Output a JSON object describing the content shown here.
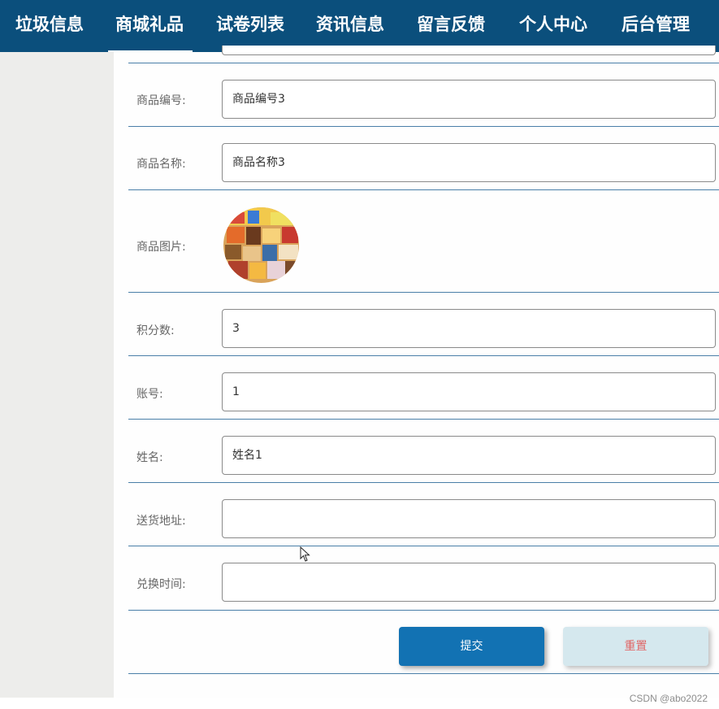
{
  "nav": {
    "items": [
      {
        "label": "垃圾信息",
        "active": false
      },
      {
        "label": "商城礼品",
        "active": true
      },
      {
        "label": "试卷列表",
        "active": false
      },
      {
        "label": "资讯信息",
        "active": false
      },
      {
        "label": "留言反馈",
        "active": false
      },
      {
        "label": "个人中心",
        "active": false
      },
      {
        "label": "后台管理",
        "active": false
      }
    ]
  },
  "form": {
    "product_no": {
      "label": "商品编号:",
      "value": "商品编号3"
    },
    "product_name": {
      "label": "商品名称:",
      "value": "商品名称3"
    },
    "product_image": {
      "label": "商品图片:"
    },
    "points": {
      "label": "积分数:",
      "value": "3"
    },
    "account": {
      "label": "账号:",
      "value": "1"
    },
    "name": {
      "label": "姓名:",
      "value": "姓名1"
    },
    "address": {
      "label": "送货地址:",
      "value": ""
    },
    "exchange_time": {
      "label": "兑换时间:",
      "value": ""
    }
  },
  "buttons": {
    "submit": "提交",
    "reset": "重置"
  },
  "watermark": "CSDN @abo2022",
  "colors": {
    "nav_bg": "#0b4f7c",
    "submit_bg": "#1272b3",
    "reset_bg": "#d5e8ee",
    "reset_text": "#e06666",
    "divider": "#4a7fa8"
  }
}
